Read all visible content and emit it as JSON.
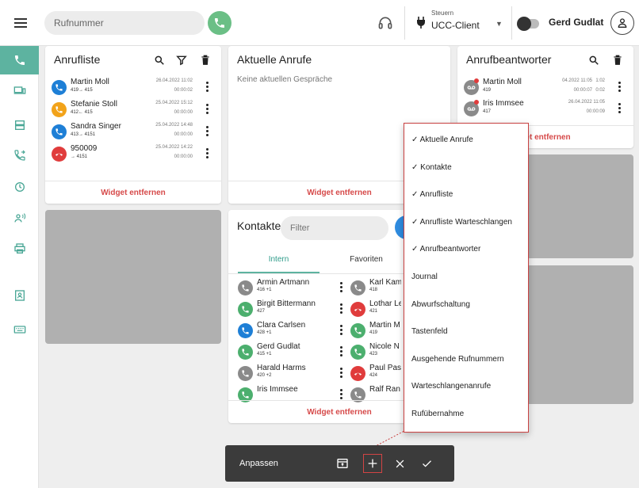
{
  "header": {
    "search_placeholder": "Rufnummer",
    "control_small": "Steuern",
    "control_main": "UCC-Client",
    "user_name": "Gerd Gudlat"
  },
  "sidebar": {
    "items": [
      {
        "icon": "phone-icon"
      },
      {
        "icon": "devices-icon"
      },
      {
        "icon": "server-icon"
      },
      {
        "icon": "call-forward-icon"
      },
      {
        "icon": "clock-icon"
      },
      {
        "icon": "user-voice-icon"
      },
      {
        "icon": "printer-icon"
      },
      {
        "icon": "contact-card-icon"
      },
      {
        "icon": "keyboard-icon"
      }
    ]
  },
  "anrufliste": {
    "title": "Anrufliste",
    "footer": "Widget entfernen",
    "rows": [
      {
        "name": "Martin Moll",
        "sub": "419→ 415",
        "date": "26.04.2022 11:02",
        "dur": "00:00:02",
        "color": "#1e7fd6",
        "icon": "outgoing-call-icon"
      },
      {
        "name": "Stefanie Stoll",
        "sub": "412← 415",
        "date": "25.04.2022 15:12",
        "dur": "00:00:00",
        "color": "#f2a31a",
        "icon": "incoming-call-icon"
      },
      {
        "name": "Sandra Singer",
        "sub": "413→ 4151",
        "date": "25.04.2022 14:48",
        "dur": "00:00:00",
        "color": "#1e7fd6",
        "icon": "outgoing-call-icon"
      },
      {
        "name": "950009",
        "sub": "→ 4151",
        "date": "25.04.2022 14:22",
        "dur": "00:00:00",
        "color": "#e03c3c",
        "icon": "missed-call-icon"
      }
    ]
  },
  "aktuelle": {
    "title": "Aktuelle Anrufe",
    "empty": "Keine aktuellen Gespräche",
    "footer": "Widget entfernen"
  },
  "anrufbeantworter": {
    "title": "Anrufbeantworter",
    "footer": "get entfernen",
    "rows": [
      {
        "name": "Martin Moll",
        "sub": "419",
        "date": "04.2022 11:05",
        "date2": "1:02",
        "dur": "00:00:07",
        "dur2": "0:02"
      },
      {
        "name": "Iris Immsee",
        "sub": "417",
        "date": "26.04.2022 11:05",
        "dur": "00:00:09"
      }
    ]
  },
  "kontakte": {
    "title": "Kontakte",
    "filter_placeholder": "Filter",
    "tabs": [
      "Intern",
      "Favoriten"
    ],
    "footer": "Widget entfernen",
    "left": [
      {
        "name": "Armin Artmann",
        "sub": "416 +1",
        "color": "#8a8a8a"
      },
      {
        "name": "Birgit Bittermann",
        "sub": "427",
        "color": "#4caf6e"
      },
      {
        "name": "Clara Carlsen",
        "sub": "428 +1",
        "color": "#1e7fd6"
      },
      {
        "name": "Gerd Gudlat",
        "sub": "415 +1",
        "color": "#4caf6e"
      },
      {
        "name": "Harald Harms",
        "sub": "420 +2",
        "color": "#8a8a8a"
      },
      {
        "name": "Iris Immsee",
        "sub": "",
        "color": "#4caf6e"
      }
    ],
    "right": [
      {
        "name": "Karl Kam",
        "sub": "418",
        "color": "#8a8a8a"
      },
      {
        "name": "Lothar Le",
        "sub": "421",
        "color": "#e03c3c"
      },
      {
        "name": "Martin M",
        "sub": "419",
        "color": "#4caf6e"
      },
      {
        "name": "Nicole N",
        "sub": "423",
        "color": "#4caf6e"
      },
      {
        "name": "Paul Pas",
        "sub": "424",
        "color": "#e03c3c"
      },
      {
        "name": "Ralf Ran",
        "sub": "",
        "color": "#8a8a8a"
      }
    ]
  },
  "dropdown": {
    "items": [
      {
        "label": "✓ Aktuelle Anrufe"
      },
      {
        "label": "✓ Kontakte"
      },
      {
        "label": "✓ Anrufliste"
      },
      {
        "label": "✓ Anrufliste Warteschlangen"
      },
      {
        "label": "✓ Anrufbeantworter"
      },
      {
        "label": "Journal"
      },
      {
        "label": "Abwurfschaltung"
      },
      {
        "label": "Tastenfeld"
      },
      {
        "label": "Ausgehende Rufnummern"
      },
      {
        "label": "Warteschlangenanrufe"
      },
      {
        "label": "Rufübernahme"
      }
    ]
  },
  "custombar": {
    "label": "Anpassen"
  },
  "colors": {
    "accent": "#5db3a0",
    "call_green": "#6bbf86",
    "danger": "#d64a4a"
  }
}
